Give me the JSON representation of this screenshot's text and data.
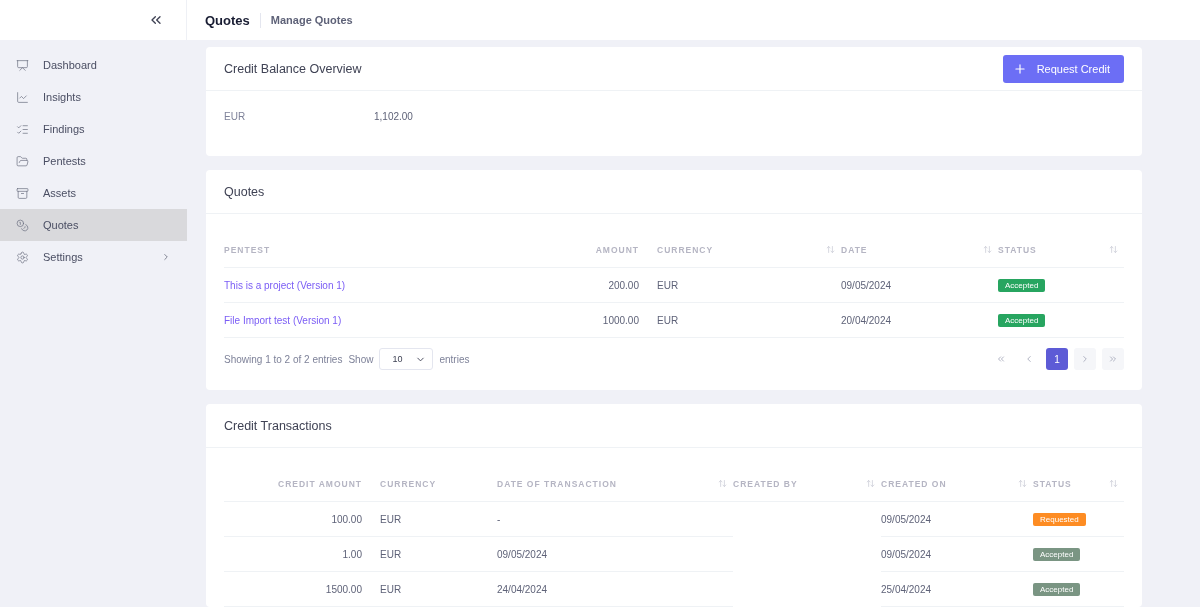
{
  "header": {
    "title": "Quotes",
    "subtitle": "Manage Quotes"
  },
  "sidebar": {
    "items": [
      {
        "label": "Dashboard",
        "kind": "dashboard",
        "selected": false,
        "has_submenu": false
      },
      {
        "label": "Insights",
        "kind": "insights",
        "selected": false,
        "has_submenu": false
      },
      {
        "label": "Findings",
        "kind": "findings",
        "selected": false,
        "has_submenu": false
      },
      {
        "label": "Pentests",
        "kind": "pentests",
        "selected": false,
        "has_submenu": false
      },
      {
        "label": "Assets",
        "kind": "assets",
        "selected": false,
        "has_submenu": false
      },
      {
        "label": "Quotes",
        "kind": "quotes",
        "selected": true,
        "has_submenu": false
      },
      {
        "label": "Settings",
        "kind": "settings",
        "selected": false,
        "has_submenu": true
      }
    ]
  },
  "balance": {
    "title": "Credit Balance Overview",
    "button": "Request Credit",
    "rows": [
      {
        "currency": "EUR",
        "amount": "1,102.00"
      }
    ]
  },
  "quotes": {
    "title": "Quotes",
    "columns": [
      {
        "label": "PENTEST",
        "sortable": false
      },
      {
        "label": "AMOUNT",
        "sortable": false
      },
      {
        "label": "CURRENCY",
        "sortable": true
      },
      {
        "label": "DATE",
        "sortable": true
      },
      {
        "label": "STATUS",
        "sortable": true
      }
    ],
    "rows": [
      {
        "pentest": "This is a project (Version 1)",
        "amount": "200.00",
        "currency": "EUR",
        "date": "09/05/2024",
        "status": {
          "label": "Accepted",
          "color": "#27a560"
        }
      },
      {
        "pentest": "File Import test (Version 1)",
        "amount": "1000.00",
        "currency": "EUR",
        "date": "20/04/2024",
        "status": {
          "label": "Accepted",
          "color": "#27a560"
        }
      }
    ],
    "footer": {
      "info": "Showing 1 to 2 of 2 entries",
      "show": "Show",
      "page_size": "10",
      "entries": "entries"
    },
    "pagination": {
      "pages": [
        {
          "label": "1",
          "selected": true
        }
      ]
    }
  },
  "transactions": {
    "title": "Credit Transactions",
    "columns": [
      {
        "label": "CREDIT AMOUNT",
        "sortable": false
      },
      {
        "label": "CURRENCY",
        "sortable": false
      },
      {
        "label": "DATE OF TRANSACTION",
        "sortable": true
      },
      {
        "label": "CREATED BY",
        "sortable": true
      },
      {
        "label": "CREATED ON",
        "sortable": true
      },
      {
        "label": "STATUS",
        "sortable": true
      }
    ],
    "rows": [
      {
        "credit_amount": "100.00",
        "currency": "EUR",
        "date_of_transaction": "-",
        "created_on": "09/05/2024",
        "status": {
          "label": "Requested",
          "color": "#fd8c23"
        }
      },
      {
        "credit_amount": "1.00",
        "currency": "EUR",
        "date_of_transaction": "09/05/2024",
        "created_on": "09/05/2024",
        "status": {
          "label": "Accepted",
          "color": "#7a9583"
        }
      },
      {
        "credit_amount": "1500.00",
        "currency": "EUR",
        "date_of_transaction": "24/04/2024",
        "created_on": "25/04/2024",
        "status": {
          "label": "Accepted",
          "color": "#7a9583"
        }
      }
    ]
  }
}
